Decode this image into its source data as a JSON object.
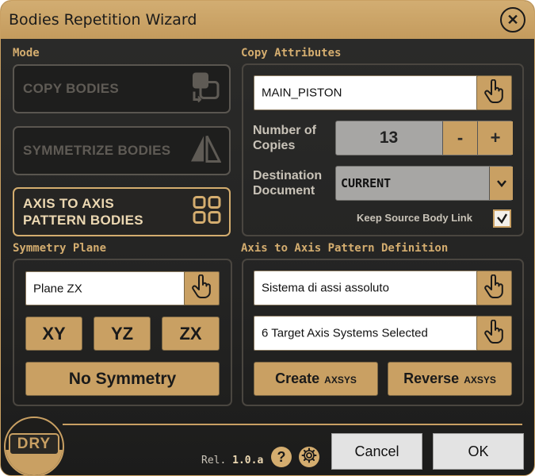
{
  "window": {
    "title": "Bodies Repetition Wizard",
    "close_glyph": "✕"
  },
  "mode": {
    "label": "Mode",
    "buttons": [
      {
        "line1": "COPY BODIES",
        "icon": "copy-bodies-icon"
      },
      {
        "line1": "SYMMETRIZE BODIES",
        "icon": "symmetrize-icon"
      },
      {
        "line1": "AXIS TO AXIS",
        "line2": "PATTERN BODIES",
        "icon": "grid-pattern-icon"
      }
    ]
  },
  "copy_attributes": {
    "label": "Copy Attributes",
    "source_value": "MAIN_PISTON",
    "copies_label_1": "Number of",
    "copies_label_2": "Copies",
    "copies_value": "13",
    "minus": "-",
    "plus": "+",
    "dest_label_1": "Destination",
    "dest_label_2": "Document",
    "dest_value": "CURRENT",
    "dest_chevron": "⌄",
    "keep_link_label": "Keep Source Body Link",
    "keep_link_checked": true
  },
  "symmetry_plane": {
    "label": "Symmetry Plane",
    "value": "Plane ZX",
    "btn_xy": "XY",
    "btn_yz": "YZ",
    "btn_zx": "ZX",
    "btn_none": "No Symmetry"
  },
  "pattern_definition": {
    "label": "Axis to Axis Pattern Definition",
    "reference_value": "Sistema di assi assoluto",
    "targets_value": "6 Target Axis Systems Selected",
    "create_main": "Create",
    "create_small": "AXSYS",
    "reverse_main": "Reverse",
    "reverse_small": "AXSYS"
  },
  "footer": {
    "logo_text": "DRY",
    "release_prefix": "Rel.",
    "release_version": "1.0.a",
    "help_glyph": "?",
    "cancel": "Cancel",
    "ok": "OK"
  },
  "colors": {
    "accent": "#c9a063",
    "background": "#262524",
    "label": "#d4ad6f"
  }
}
